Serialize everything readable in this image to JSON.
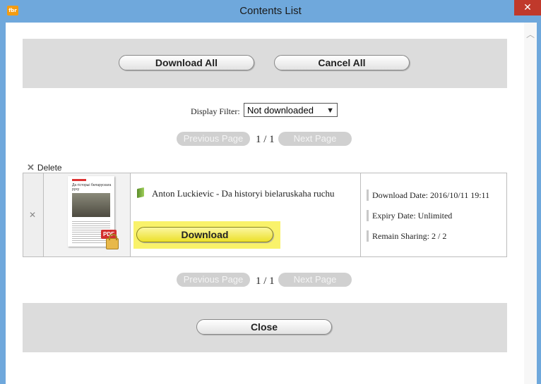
{
  "window": {
    "title": "Contents List",
    "app_icon": "app-icon"
  },
  "toolbar": {
    "download_all": "Download All",
    "cancel_all": "Cancel All"
  },
  "filter": {
    "label": "Display Filter:",
    "value": "Not downloaded"
  },
  "pagination": {
    "prev": "Previous Page",
    "next": "Next Page",
    "page": "1 / 1"
  },
  "list": {
    "delete_label": "Delete"
  },
  "item": {
    "thumb_title": "Да гісторыі беларускага руху",
    "badge": "PDF",
    "title": "Anton Luckievic - Da historyi bielaruskaha ruchu",
    "download_label": "Download",
    "download_date": "Download Date: 2016/10/11 19:11",
    "expiry_date": "Expiry Date: Unlimited",
    "remain_sharing": "Remain Sharing: 2 / 2"
  },
  "footer": {
    "close_label": "Close"
  },
  "colors": {
    "titlebar": "#6fa8dc",
    "close_button": "#c0392b",
    "highlight": "#f9f26a",
    "panel": "#dcdcdc"
  }
}
